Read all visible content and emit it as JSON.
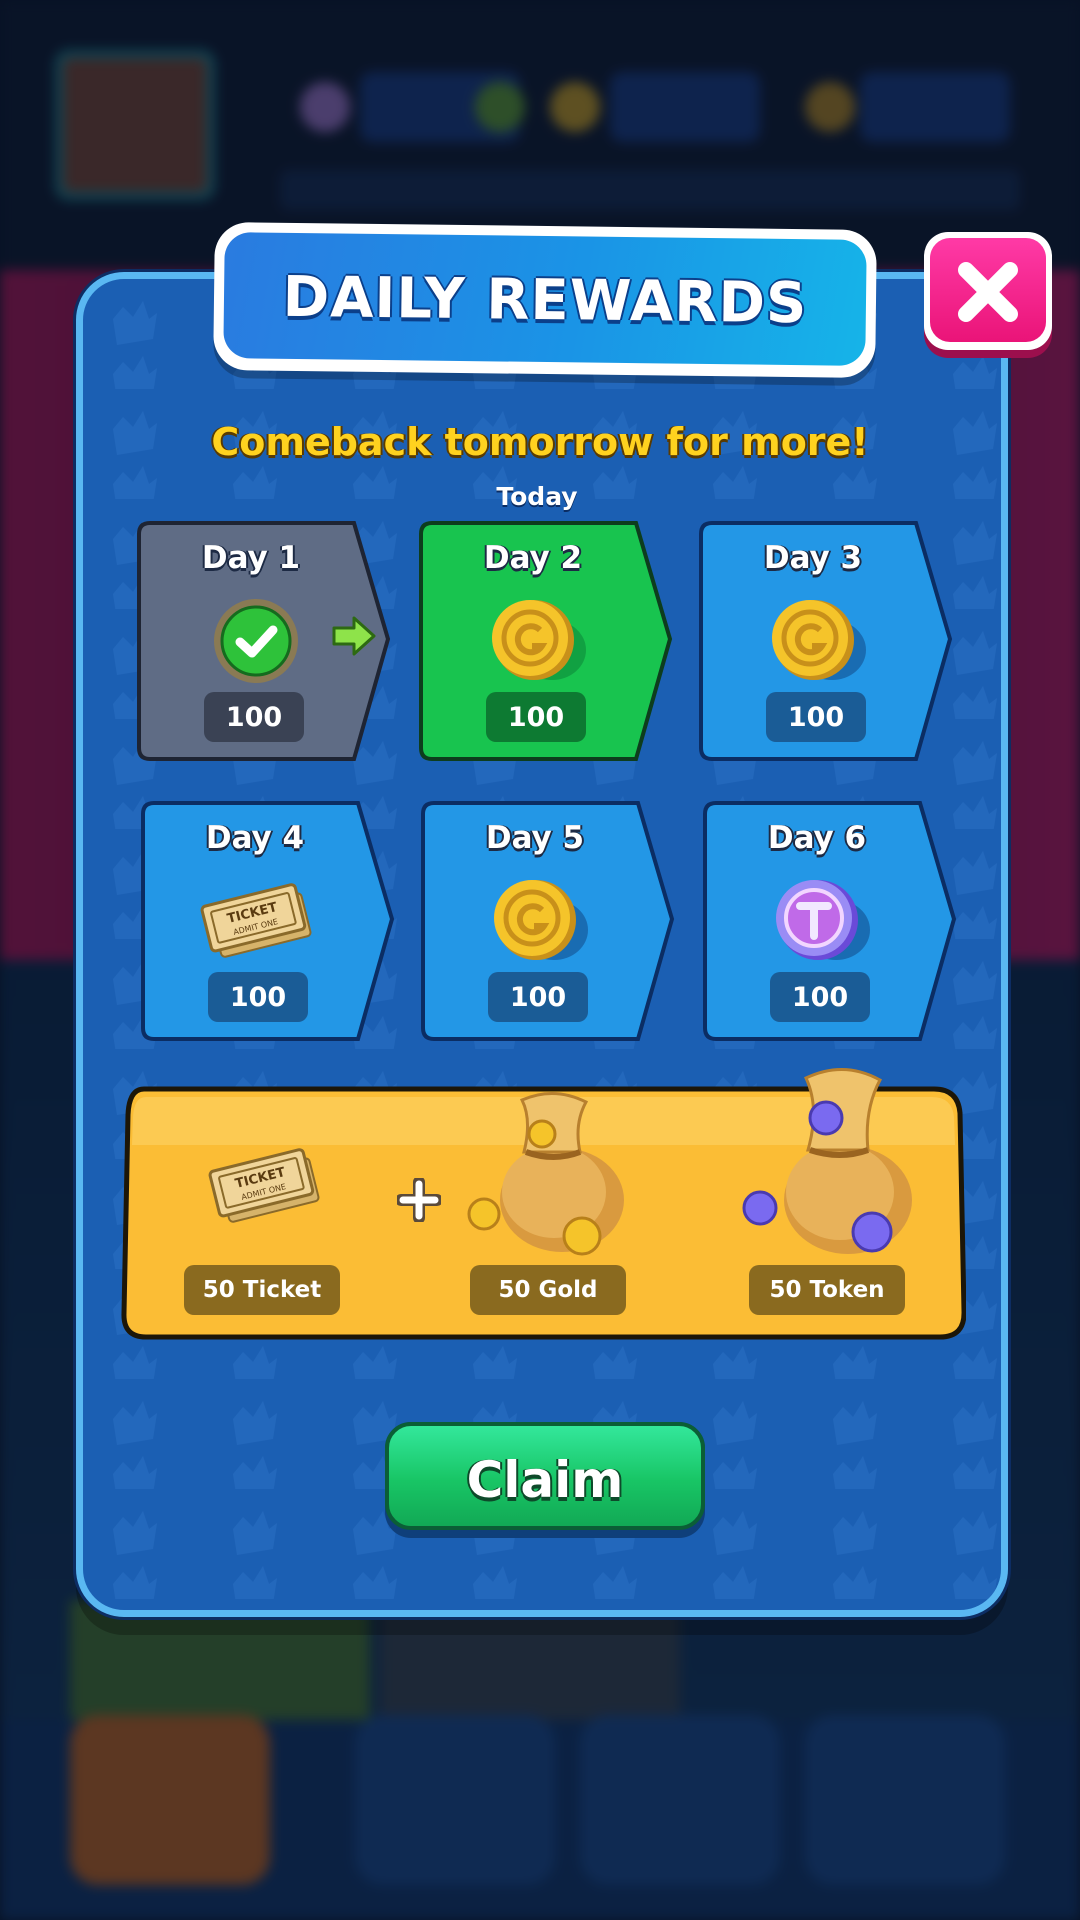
{
  "modal": {
    "title": "DAILY REWARDS",
    "subtitle": "Comeback tomorrow for more!",
    "today_label": "Today",
    "claim_label": "Claim",
    "close_icon": "close-icon"
  },
  "days": [
    {
      "label": "Day 1",
      "amount": "100",
      "icon": "checkmark-icon",
      "state": "claimed"
    },
    {
      "label": "Day 2",
      "amount": "100",
      "icon": "gold-coin-icon",
      "state": "today"
    },
    {
      "label": "Day 3",
      "amount": "100",
      "icon": "gold-coin-icon",
      "state": "locked"
    },
    {
      "label": "Day 4",
      "amount": "100",
      "icon": "ticket-icon",
      "state": "locked"
    },
    {
      "label": "Day 5",
      "amount": "100",
      "icon": "gold-coin-icon",
      "state": "locked"
    },
    {
      "label": "Day 6",
      "amount": "100",
      "icon": "token-coin-icon",
      "state": "locked"
    }
  ],
  "bonus": {
    "items": [
      {
        "label": "50 Ticket",
        "icon": "ticket-icon"
      },
      {
        "label": "50 Gold",
        "icon": "gold-bag-icon"
      },
      {
        "label": "50 Token",
        "icon": "token-bag-icon"
      }
    ]
  },
  "colors": {
    "claimed": "#5f6c85",
    "today": "#18c44f",
    "locked": "#2397e6",
    "bonus": "#fbbd35",
    "accent_text": "#ffd21f",
    "close": "#ff2a95",
    "claim": "#1fd072"
  }
}
